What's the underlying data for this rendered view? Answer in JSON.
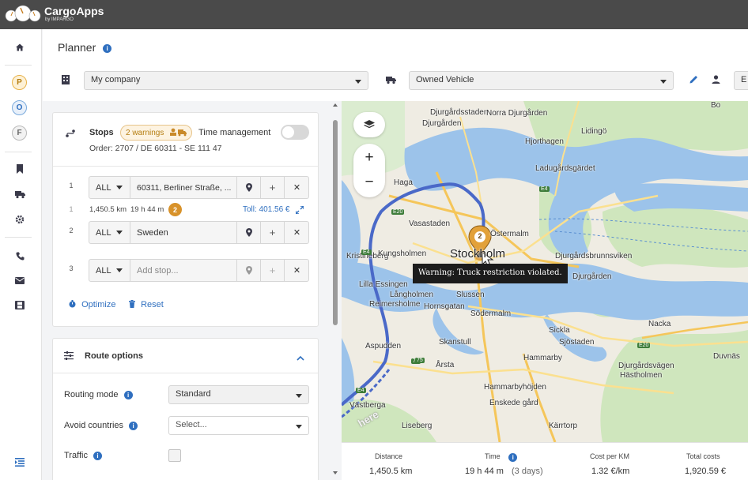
{
  "app": {
    "name": "CargoApps",
    "byline": "by IMPARGO"
  },
  "sidebar": {
    "circles": [
      {
        "letter": "P",
        "border": "#e8b24a",
        "bg": "#fdf1d6",
        "color": "#b57d10"
      },
      {
        "letter": "O",
        "border": "#7aaadc",
        "bg": "#e8f0fa",
        "color": "#2f6fbf"
      },
      {
        "letter": "F",
        "border": "#b9b9b9",
        "bg": "#f2f2f2",
        "color": "#666"
      }
    ],
    "icons": [
      "home-icon",
      "bookmark-icon",
      "truck-icon",
      "gear-icon",
      "phone-icon",
      "mail-icon",
      "film-icon",
      "list-collapse-icon"
    ]
  },
  "header": {
    "title": "Planner",
    "company": "My company",
    "vehicle": "Owned Vehicle",
    "extra_select": "E"
  },
  "stops_card": {
    "title": "Stops",
    "warnings": "2 warnings",
    "time_management": "Time management",
    "order": "Order: 2707 / DE 60311 - SE 111 47",
    "stops": [
      {
        "num": "1",
        "type": "ALL",
        "address": "60311, Berliner Straße, ...",
        "placeholder": ""
      },
      {
        "num": "2",
        "type": "ALL",
        "address": "Sweden",
        "placeholder": ""
      },
      {
        "num": "3",
        "type": "ALL",
        "address": "",
        "placeholder": "Add stop..."
      }
    ],
    "leg": {
      "num": "1",
      "distance": "1,450.5 km",
      "time": "19 h 44 m",
      "badge": "2",
      "toll": "Toll: 401.56 €"
    },
    "optimize": "Optimize",
    "reset": "Reset"
  },
  "route_options": {
    "title": "Route options",
    "routing_mode_label": "Routing mode",
    "routing_mode_value": "Standard",
    "avoid_countries_label": "Avoid countries",
    "avoid_countries_placeholder": "Select...",
    "traffic_label": "Traffic"
  },
  "map": {
    "labels": [
      {
        "t": "Lidingö",
        "big": false
      },
      {
        "t": "Djurgårdsstaden",
        "big": false
      },
      {
        "t": "Norra Djurgården",
        "big": false
      },
      {
        "t": "Hjorthagen",
        "big": false
      },
      {
        "t": "Djurgården",
        "big": false
      },
      {
        "t": "Ladugårdsgärdet",
        "big": false
      },
      {
        "t": "Haga",
        "big": false
      },
      {
        "t": "Vasastaden",
        "big": false
      },
      {
        "t": "Östermalm",
        "big": false
      },
      {
        "t": "Kristineberg",
        "big": false
      },
      {
        "t": "Kungsholmen",
        "big": false
      },
      {
        "t": "Stockholm",
        "big": true
      },
      {
        "t": "Djurgårdsbrunnsviken",
        "big": false
      },
      {
        "t": "Djurgården",
        "big": false
      },
      {
        "t": "Lilla Essingen",
        "big": false
      },
      {
        "t": "Långholmen",
        "big": false
      },
      {
        "t": "Reimersholme",
        "big": false
      },
      {
        "t": "Hornsgatan",
        "big": false
      },
      {
        "t": "Södermalm",
        "big": false
      },
      {
        "t": "Sickla",
        "big": false
      },
      {
        "t": "Nacka",
        "big": false
      },
      {
        "t": "Aspudden",
        "big": false
      },
      {
        "t": "Årsta",
        "big": false
      },
      {
        "t": "Hammarbyhöjden",
        "big": false
      },
      {
        "t": "Hästholmen",
        "big": false
      },
      {
        "t": "Enskede gård",
        "big": false
      },
      {
        "t": "Liseberg",
        "big": false
      },
      {
        "t": "Kärrtorp",
        "big": false
      },
      {
        "t": "Västberga",
        "big": false
      },
      {
        "t": "Skanstull",
        "big": false
      },
      {
        "t": "Slussen",
        "big": false
      },
      {
        "t": "Sjöstaden",
        "big": false
      },
      {
        "t": "Hammarby",
        "big": false
      },
      {
        "t": "Djurgårdsvägen",
        "big": false
      },
      {
        "t": "Duvnäs",
        "big": false
      },
      {
        "t": "Bo",
        "big": false
      }
    ],
    "badges": [
      "E20",
      "E4",
      "E4",
      "75",
      "75",
      "E20",
      "E4"
    ],
    "pin_count": "2",
    "tooltip": "Warning: Truck restriction violated.",
    "watermark": "here"
  },
  "stats": {
    "distance_label": "Distance",
    "distance_value": "1,450.5 km",
    "time_label": "Time",
    "time_value": "19 h 44 m",
    "time_days": "(3 days)",
    "cost_km_label": "Cost per KM",
    "cost_km_value": "1.32 €/km",
    "total_label": "Total costs",
    "total_value": "1,920.59 €"
  },
  "colors": {
    "accent": "#2f6fbf",
    "warning": "#d8922a",
    "route": "#4a69c8"
  }
}
